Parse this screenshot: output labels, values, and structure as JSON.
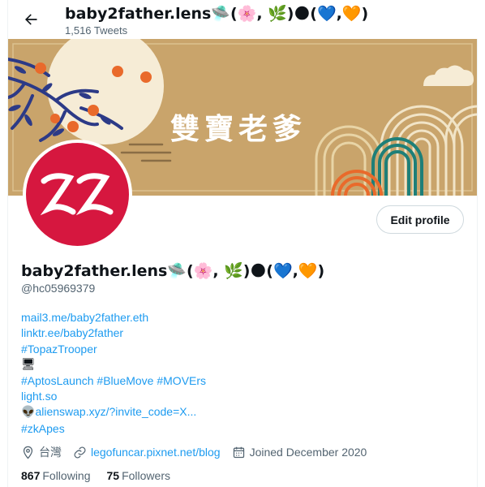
{
  "header": {
    "back_icon": "arrow-left-icon",
    "display_name": "baby2father.lens🛸(🌸, 🌿)🌑(💙,🧡)",
    "tweet_count": "1,516 Tweets"
  },
  "banner": {
    "title_text": "雙寶老爹",
    "background_color": "#c9a46b"
  },
  "avatar": {
    "letters": "ZZ",
    "background_color": "#d6173f"
  },
  "profile": {
    "edit_button_label": "Edit profile",
    "display_name": "baby2father.lens🛸(🌸, 🌿)🌑(💙,🧡)",
    "handle": "@hc05969379"
  },
  "bio": {
    "line1": "mail3.me/baby2father.eth",
    "line2": "linktr.ee/baby2father",
    "line3": "#TopazTrooper",
    "line4": "🖥",
    "line5_tag1": "#AptosLaunch",
    "line5_tag2": "#BlueMove",
    "line5_tag3": "#MOVErs",
    "line6": "light.so",
    "line7_emoji": "👽",
    "line7_link": "alienswap.xyz/?invite_code=X...",
    "line8": "#zkApes"
  },
  "meta": {
    "location": "台灣",
    "website": "legofuncar.pixnet.net/blog",
    "joined": "Joined December 2020"
  },
  "follow": {
    "following_count": "867",
    "following_label": "Following",
    "followers_count": "75",
    "followers_label": "Followers"
  },
  "colors": {
    "link": "#1d9bf0",
    "secondary_text": "#536471"
  }
}
